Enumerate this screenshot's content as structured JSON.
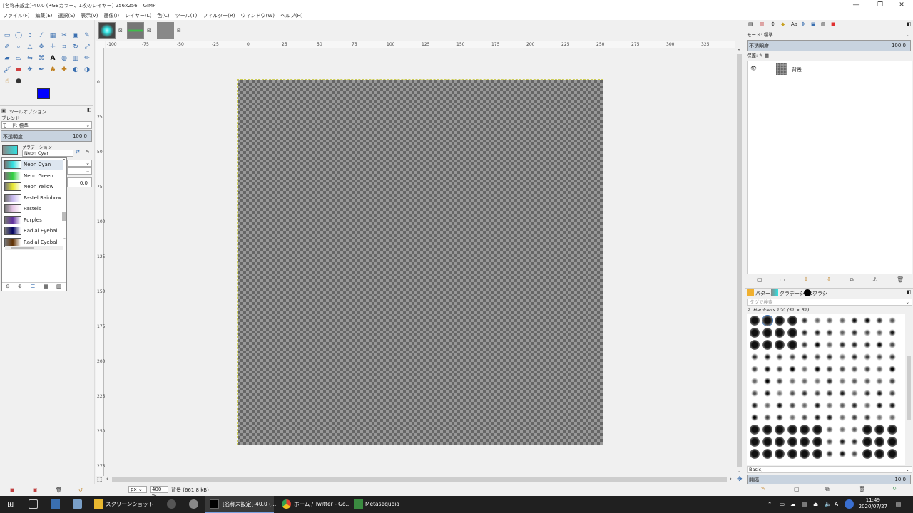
{
  "window": {
    "title": "[名称未設定]-40.0 (RGBカラー、1枚のレイヤー) 256x256 – GIMP",
    "controls": [
      "—",
      "❐",
      "✕"
    ]
  },
  "menubar": [
    "ファイル(F)",
    "編集(E)",
    "選択(S)",
    "表示(V)",
    "画像(I)",
    "レイヤー(L)",
    "色(C)",
    "ツール(T)",
    "フィルター(R)",
    "ウィンドウ(W)",
    "ヘルプ(H)"
  ],
  "colors": {
    "foreground": "#0000ff",
    "background": "#ffffff",
    "taskbar": "#202020"
  },
  "tool_options": {
    "tab_label": "ツールオプション",
    "tool_name": "ブレンド",
    "mode_label": "モード",
    "mode_value": "標準",
    "opacity_label": "不透明度",
    "opacity_value": "100.0",
    "gradient_label": "グラデーション",
    "gradient_value": "Neon Cyan",
    "offset_value": "0.0"
  },
  "gradient_list": [
    {
      "name": "Neon Cyan",
      "color": "#30e0e0"
    },
    {
      "name": "Neon Green",
      "color": "#30d040"
    },
    {
      "name": "Neon Yellow",
      "color": "#e8e830"
    },
    {
      "name": "Pastel Rainbow",
      "color": "#c8b8f0"
    },
    {
      "name": "Pastels",
      "color": "#e8c8e8"
    },
    {
      "name": "Purples",
      "color": "#6030a0"
    },
    {
      "name": "Radial Eyeball B",
      "color": "#000060"
    },
    {
      "name": "Radial Eyeball B",
      "color": "#603000"
    }
  ],
  "ruler": {
    "h_ticks": [
      "-100",
      "-75",
      "-50",
      "-25",
      "0",
      "25",
      "50",
      "75",
      "100",
      "125",
      "150",
      "175",
      "200",
      "225",
      "250",
      "275",
      "300",
      "325"
    ],
    "v_ticks": [
      "0",
      "25",
      "50",
      "75",
      "100",
      "125",
      "150",
      "175",
      "200",
      "225",
      "250",
      "275"
    ]
  },
  "statusbar": {
    "unit": "px",
    "zoom": "400 %",
    "layer_info": "背景 (661.8 kB)"
  },
  "layers_panel": {
    "mode_label": "モード",
    "mode_value": "標準",
    "opacity_label": "不透明度",
    "opacity_value": "100.0",
    "lock_label": "保護:",
    "layer_name": "背景"
  },
  "brushes_panel": {
    "tabs": [
      "パターン",
      "グラデーション",
      "ブラシ"
    ],
    "search_placeholder": "タグで検索",
    "brush_title": "2. Hardness 100 (51 × 51)",
    "preset": "Basic,",
    "spacing_label": "間隔",
    "spacing_value": "10.0"
  },
  "taskbar": {
    "items": [
      "スクリーンショット",
      "[名称未設定]-40.0 (...",
      "ホーム / Twitter - Go...",
      "Metasequoia"
    ],
    "time": "11:49",
    "date": "2020/07/27",
    "ime": "A"
  }
}
